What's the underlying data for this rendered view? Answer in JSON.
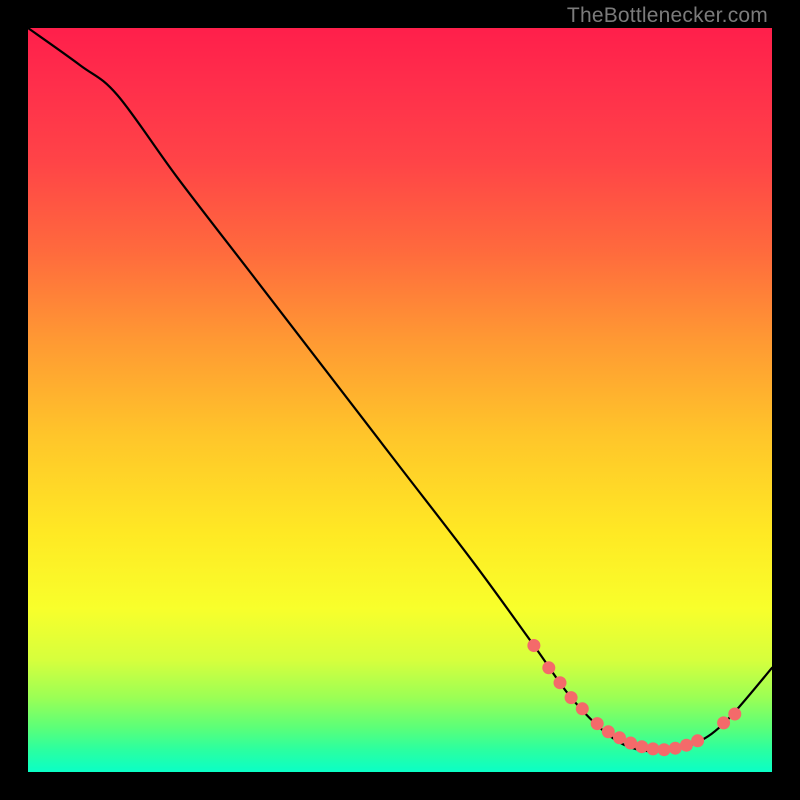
{
  "attribution": "TheBottlenecker.com",
  "colors": {
    "dot": "#f46a6a",
    "curve": "#000000",
    "background": "#000000"
  },
  "chart_data": {
    "type": "line",
    "title": "",
    "xlabel": "",
    "ylabel": "",
    "xlim": [
      0,
      100
    ],
    "ylim": [
      0,
      100
    ],
    "series": [
      {
        "name": "curve",
        "x": [
          0,
          7,
          12,
          20,
          30,
          40,
          50,
          60,
          68,
          73,
          78,
          82,
          86,
          90,
          94,
          100
        ],
        "y": [
          100,
          95,
          91,
          80,
          67,
          54,
          41,
          28,
          17,
          10,
          5,
          3,
          3,
          4,
          7,
          14
        ]
      }
    ],
    "markers": [
      {
        "x": 68.0,
        "y": 17.0
      },
      {
        "x": 70.0,
        "y": 14.0
      },
      {
        "x": 71.5,
        "y": 12.0
      },
      {
        "x": 73.0,
        "y": 10.0
      },
      {
        "x": 74.5,
        "y": 8.5
      },
      {
        "x": 76.5,
        "y": 6.5
      },
      {
        "x": 78.0,
        "y": 5.4
      },
      {
        "x": 79.5,
        "y": 4.6
      },
      {
        "x": 81.0,
        "y": 3.9
      },
      {
        "x": 82.5,
        "y": 3.4
      },
      {
        "x": 84.0,
        "y": 3.1
      },
      {
        "x": 85.5,
        "y": 3.0
      },
      {
        "x": 87.0,
        "y": 3.2
      },
      {
        "x": 88.5,
        "y": 3.6
      },
      {
        "x": 90.0,
        "y": 4.2
      },
      {
        "x": 93.5,
        "y": 6.6
      },
      {
        "x": 95.0,
        "y": 7.8
      }
    ],
    "legend": false,
    "grid": false
  }
}
